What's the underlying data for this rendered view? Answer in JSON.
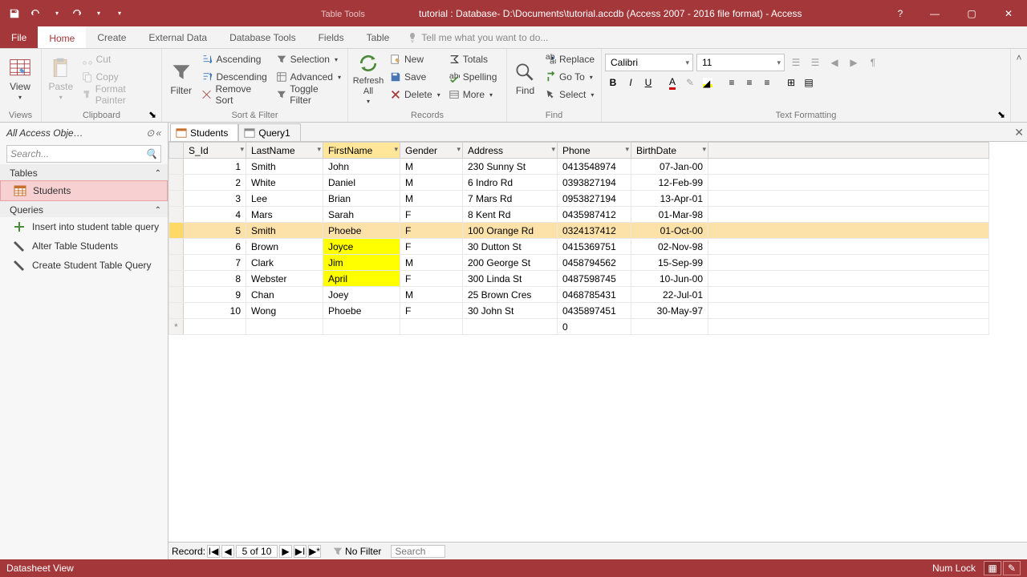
{
  "titlebar": {
    "table_tools": "Table Tools",
    "title": "tutorial : Database- D:\\Documents\\tutorial.accdb (Access 2007 - 2016 file format) - Access"
  },
  "ribbon_tabs": [
    "File",
    "Home",
    "Create",
    "External Data",
    "Database Tools",
    "Fields",
    "Table"
  ],
  "tellme_placeholder": "Tell me what you want to do...",
  "ribbon": {
    "views": {
      "label": "Views",
      "view": "View"
    },
    "clipboard": {
      "label": "Clipboard",
      "paste": "Paste",
      "cut": "Cut",
      "copy": "Copy",
      "format_painter": "Format Painter"
    },
    "sort_filter": {
      "label": "Sort & Filter",
      "filter": "Filter",
      "ascending": "Ascending",
      "descending": "Descending",
      "remove_sort": "Remove Sort",
      "selection": "Selection",
      "advanced": "Advanced",
      "toggle_filter": "Toggle Filter"
    },
    "records": {
      "label": "Records",
      "refresh": "Refresh All",
      "new": "New",
      "save": "Save",
      "delete": "Delete",
      "totals": "Totals",
      "spelling": "Spelling",
      "more": "More"
    },
    "find": {
      "label": "Find",
      "find": "Find",
      "replace": "Replace",
      "goto": "Go To",
      "select": "Select"
    },
    "text_formatting": {
      "label": "Text Formatting",
      "font": "Calibri",
      "size": "11"
    }
  },
  "nav": {
    "header": "All Access Obje…",
    "search_placeholder": "Search...",
    "sections": {
      "tables": "Tables",
      "queries": "Queries"
    },
    "tables": [
      "Students"
    ],
    "queries": [
      "Insert into student table query",
      "Alter Table Students",
      "Create Student Table Query"
    ]
  },
  "doc_tabs": {
    "students": "Students",
    "query1": "Query1"
  },
  "grid": {
    "columns": {
      "sid": "S_Id",
      "lname": "LastName",
      "fname": "FirstName",
      "gender": "Gender",
      "addr": "Address",
      "phone": "Phone",
      "bdate": "BirthDate"
    },
    "rows": [
      {
        "sid": "1",
        "lname": "Smith",
        "fname": "John",
        "gender": "M",
        "addr": "230 Sunny St",
        "phone": "0413548974",
        "bdate": "07-Jan-00"
      },
      {
        "sid": "2",
        "lname": "White",
        "fname": "Daniel",
        "gender": "M",
        "addr": "6 Indro Rd",
        "phone": "0393827194",
        "bdate": "12-Feb-99"
      },
      {
        "sid": "3",
        "lname": "Lee",
        "fname": "Brian",
        "gender": "M",
        "addr": "7 Mars Rd",
        "phone": "0953827194",
        "bdate": "13-Apr-01"
      },
      {
        "sid": "4",
        "lname": "Mars",
        "fname": "Sarah",
        "gender": "F",
        "addr": "8 Kent Rd",
        "phone": "0435987412",
        "bdate": "01-Mar-98"
      },
      {
        "sid": "5",
        "lname": "Smith",
        "fname": "Phoebe",
        "gender": "F",
        "addr": "100 Orange Rd",
        "phone": "0324137412",
        "bdate": "01-Oct-00"
      },
      {
        "sid": "6",
        "lname": "Brown",
        "fname": "Joyce",
        "gender": "F",
        "addr": "30 Dutton St",
        "phone": "0415369751",
        "bdate": "02-Nov-98"
      },
      {
        "sid": "7",
        "lname": "Clark",
        "fname": "Jim",
        "gender": "M",
        "addr": "200 George St",
        "phone": "0458794562",
        "bdate": "15-Sep-99"
      },
      {
        "sid": "8",
        "lname": "Webster",
        "fname": "April",
        "gender": "F",
        "addr": "300 Linda St",
        "phone": "0487598745",
        "bdate": "10-Jun-00"
      },
      {
        "sid": "9",
        "lname": "Chan",
        "fname": "Joey",
        "gender": "M",
        "addr": "25 Brown Cres",
        "phone": "0468785431",
        "bdate": "22-Jul-01"
      },
      {
        "sid": "10",
        "lname": "Wong",
        "fname": "Phoebe",
        "gender": "F",
        "addr": "30 John St",
        "phone": "0435897451",
        "bdate": "30-May-97"
      }
    ],
    "new_row_phone": "0",
    "selected_row": 5,
    "highlighted_column": "fname",
    "highlight_cells_rows": [
      6,
      7,
      8
    ]
  },
  "record_nav": {
    "label": "Record:",
    "current": "5 of 10",
    "no_filter": "No Filter",
    "search": "Search"
  },
  "statusbar": {
    "view": "Datasheet View",
    "numlock": "Num Lock"
  }
}
